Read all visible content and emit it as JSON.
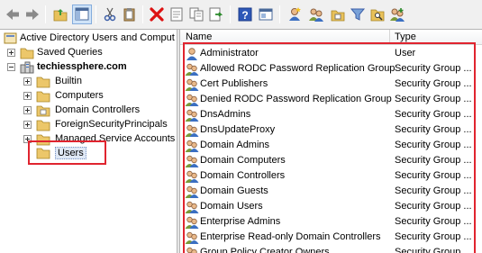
{
  "tree": {
    "root": {
      "label": "Active Directory Users and Comput"
    },
    "saved_queries": {
      "label": "Saved Queries"
    },
    "domain": {
      "label": "techiessphere.com"
    },
    "children": [
      {
        "label": "Builtin"
      },
      {
        "label": "Computers"
      },
      {
        "label": "Domain Controllers"
      },
      {
        "label": "ForeignSecurityPrincipals"
      },
      {
        "label": "Managed Service Accounts"
      },
      {
        "label": "Users"
      }
    ]
  },
  "list": {
    "columns": {
      "name": "Name",
      "type": "Type"
    },
    "rows": [
      {
        "name": "Administrator",
        "type": "User",
        "icon": "user-icon"
      },
      {
        "name": "Allowed RODC Password Replication Group",
        "type": "Security Group ...",
        "icon": "group-icon"
      },
      {
        "name": "Cert Publishers",
        "type": "Security Group ...",
        "icon": "group-icon"
      },
      {
        "name": "Denied RODC Password Replication Group",
        "type": "Security Group ...",
        "icon": "group-icon"
      },
      {
        "name": "DnsAdmins",
        "type": "Security Group ...",
        "icon": "group-icon"
      },
      {
        "name": "DnsUpdateProxy",
        "type": "Security Group ...",
        "icon": "group-icon"
      },
      {
        "name": "Domain Admins",
        "type": "Security Group ...",
        "icon": "group-icon"
      },
      {
        "name": "Domain Computers",
        "type": "Security Group ...",
        "icon": "group-icon"
      },
      {
        "name": "Domain Controllers",
        "type": "Security Group ...",
        "icon": "group-icon"
      },
      {
        "name": "Domain Guests",
        "type": "Security Group ...",
        "icon": "group-icon"
      },
      {
        "name": "Domain Users",
        "type": "Security Group ...",
        "icon": "group-icon"
      },
      {
        "name": "Enterprise Admins",
        "type": "Security Group ...",
        "icon": "group-icon"
      },
      {
        "name": "Enterprise Read-only Domain Controllers",
        "type": "Security Group ...",
        "icon": "group-icon"
      },
      {
        "name": "Group Policy Creator Owners",
        "type": "Security Group ...",
        "icon": "group-icon"
      }
    ]
  },
  "toolbar": {
    "icons": [
      "back-arrow-icon",
      "forward-arrow-icon",
      "up-folder-icon",
      "show-hide-tree-icon",
      "cut-icon",
      "paste-icon",
      "delete-icon",
      "properties-icon",
      "copy-icon",
      "export-icon",
      "help-icon",
      "console-icon",
      "new-user-icon",
      "new-group-icon",
      "new-ou-icon",
      "filter-icon",
      "find-icon",
      "add-to-group-icon"
    ]
  },
  "colors": {
    "highlight": "#e0242f",
    "toolbar_bg": "#f0f0f0"
  }
}
